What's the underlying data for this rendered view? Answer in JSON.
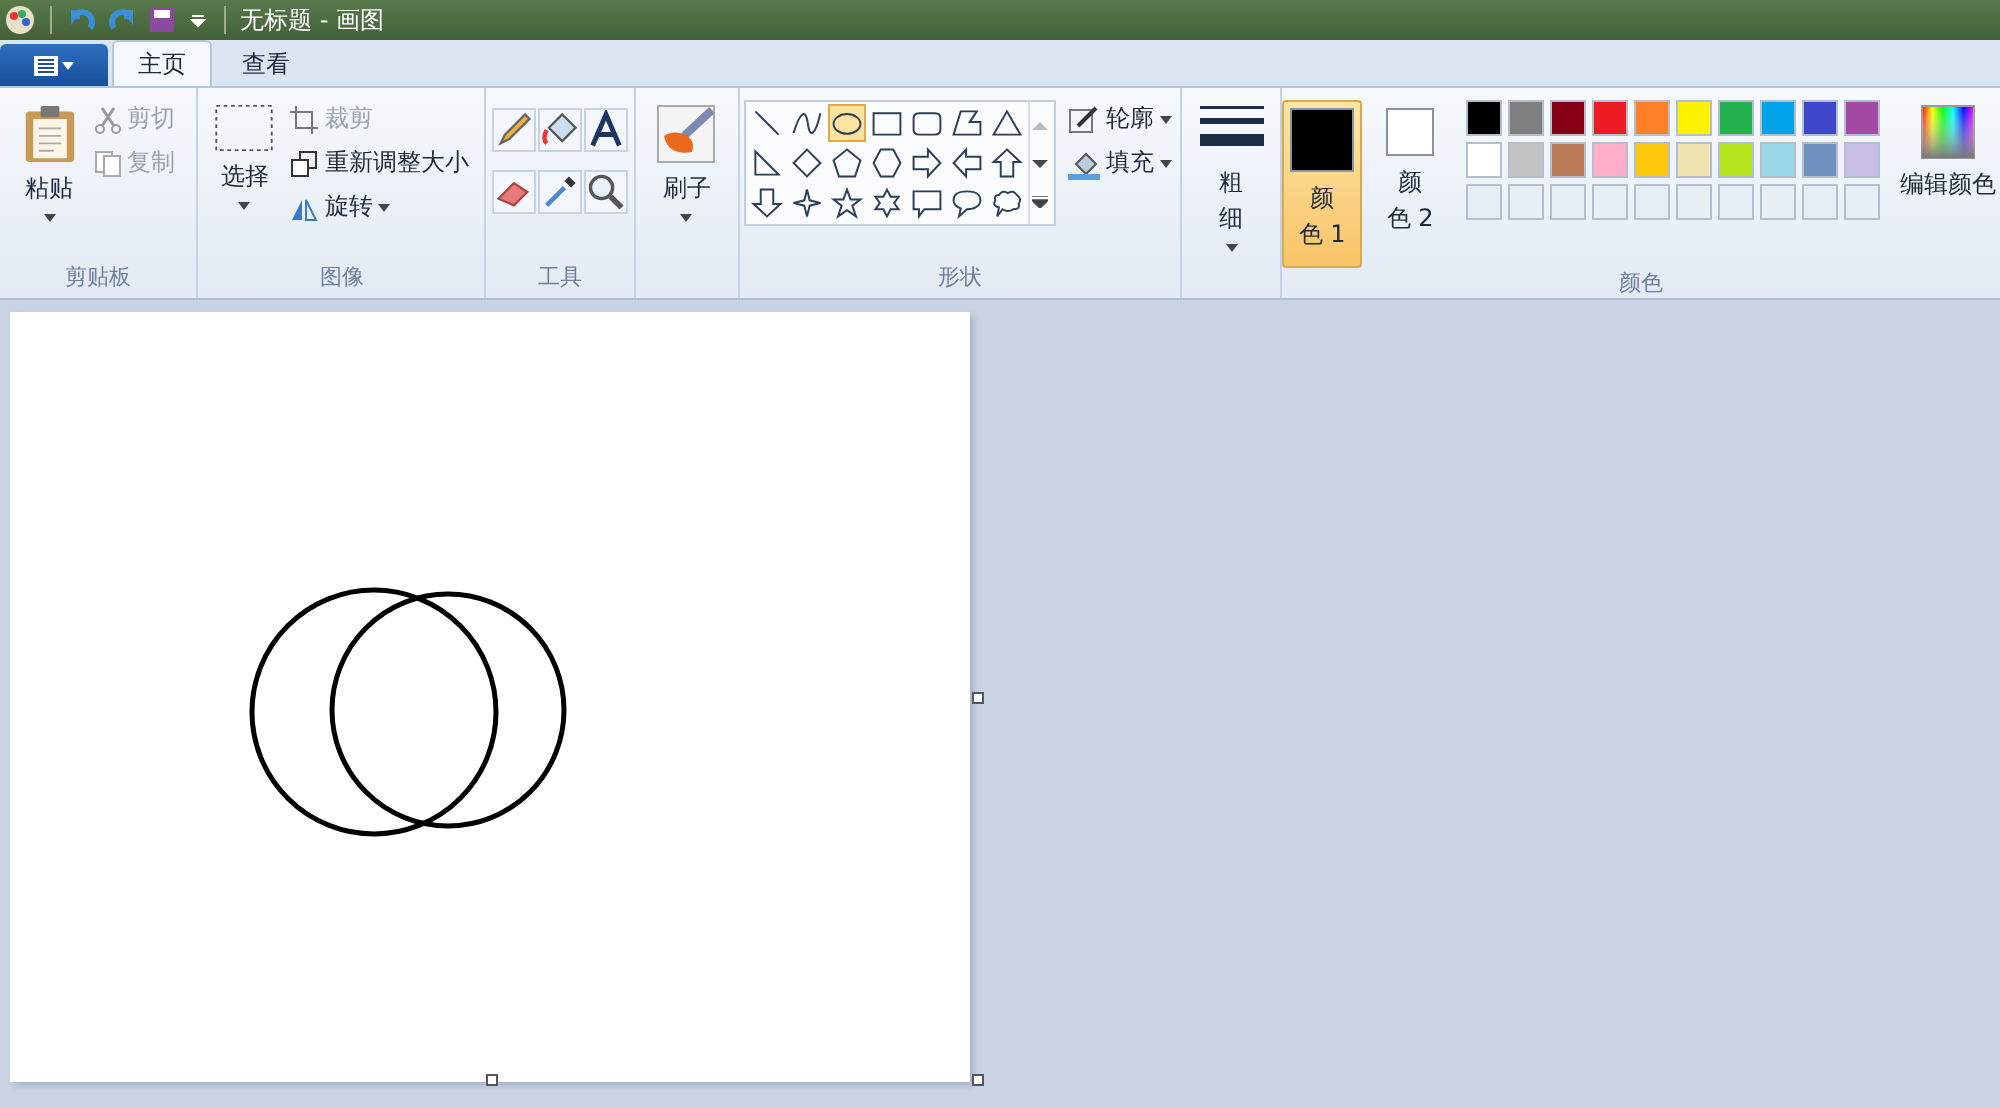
{
  "title_bar": {
    "title": "无标题 - 画图"
  },
  "tabs": [
    {
      "label": "主页",
      "selected": true
    },
    {
      "label": "查看",
      "selected": false
    }
  ],
  "clipboard": {
    "label": "剪贴板",
    "paste": "粘贴",
    "cut": {
      "label": "剪切",
      "disabled": true
    },
    "copy": {
      "label": "复制",
      "disabled": true
    }
  },
  "image": {
    "label": "图像",
    "select": "选择",
    "crop": {
      "label": "裁剪",
      "disabled": true
    },
    "resize": "重新调整大小",
    "rotate": "旋转"
  },
  "tools": {
    "label": "工具"
  },
  "brushes": {
    "label": "刷子"
  },
  "shapes": {
    "label": "形状",
    "outline": "轮廓",
    "fill": "填充",
    "items": [
      {
        "kind": "line",
        "selected": false
      },
      {
        "kind": "curve",
        "selected": false
      },
      {
        "kind": "oval",
        "selected": true
      },
      {
        "kind": "rect",
        "selected": false
      },
      {
        "kind": "roundrect",
        "selected": false
      },
      {
        "kind": "polygon",
        "selected": false
      },
      {
        "kind": "triangle",
        "selected": false
      },
      {
        "kind": "right-triangle",
        "selected": false
      },
      {
        "kind": "diamond",
        "selected": false
      },
      {
        "kind": "pentagon",
        "selected": false
      },
      {
        "kind": "hexagon",
        "selected": false
      },
      {
        "kind": "arrow-right",
        "selected": false
      },
      {
        "kind": "arrow-left",
        "selected": false
      },
      {
        "kind": "arrow-up",
        "selected": false
      },
      {
        "kind": "arrow-down",
        "selected": false
      },
      {
        "kind": "star4",
        "selected": false
      },
      {
        "kind": "star5",
        "selected": false
      },
      {
        "kind": "star6",
        "selected": false
      },
      {
        "kind": "callout-rect",
        "selected": false
      },
      {
        "kind": "callout-oval",
        "selected": false
      },
      {
        "kind": "callout-cloud",
        "selected": false
      }
    ]
  },
  "size": {
    "label": "粗细"
  },
  "colors": {
    "label": "颜色",
    "color1": {
      "label": "颜色 1",
      "color": "#000000",
      "selected": true
    },
    "color2": {
      "label": "颜色 2",
      "color": "#ffffff",
      "selected": false
    },
    "palette": [
      {
        "color": "#000000"
      },
      {
        "color": "#7f7f7f"
      },
      {
        "color": "#880015"
      },
      {
        "color": "#ed1c24"
      },
      {
        "color": "#ff7f27"
      },
      {
        "color": "#fff200"
      },
      {
        "color": "#22b14c"
      },
      {
        "color": "#00a2e8"
      },
      {
        "color": "#3f48cc"
      },
      {
        "color": "#a349a4"
      },
      {
        "color": "#ffffff"
      },
      {
        "color": "#c3c3c3"
      },
      {
        "color": "#b97a57"
      },
      {
        "color": "#ffaec9"
      },
      {
        "color": "#ffc90e"
      },
      {
        "color": "#efe4b0"
      },
      {
        "color": "#b5e61d"
      },
      {
        "color": "#99d9ea"
      },
      {
        "color": "#7092be"
      },
      {
        "color": "#c8bfe7"
      }
    ],
    "edit_colors": "编辑颜色"
  }
}
